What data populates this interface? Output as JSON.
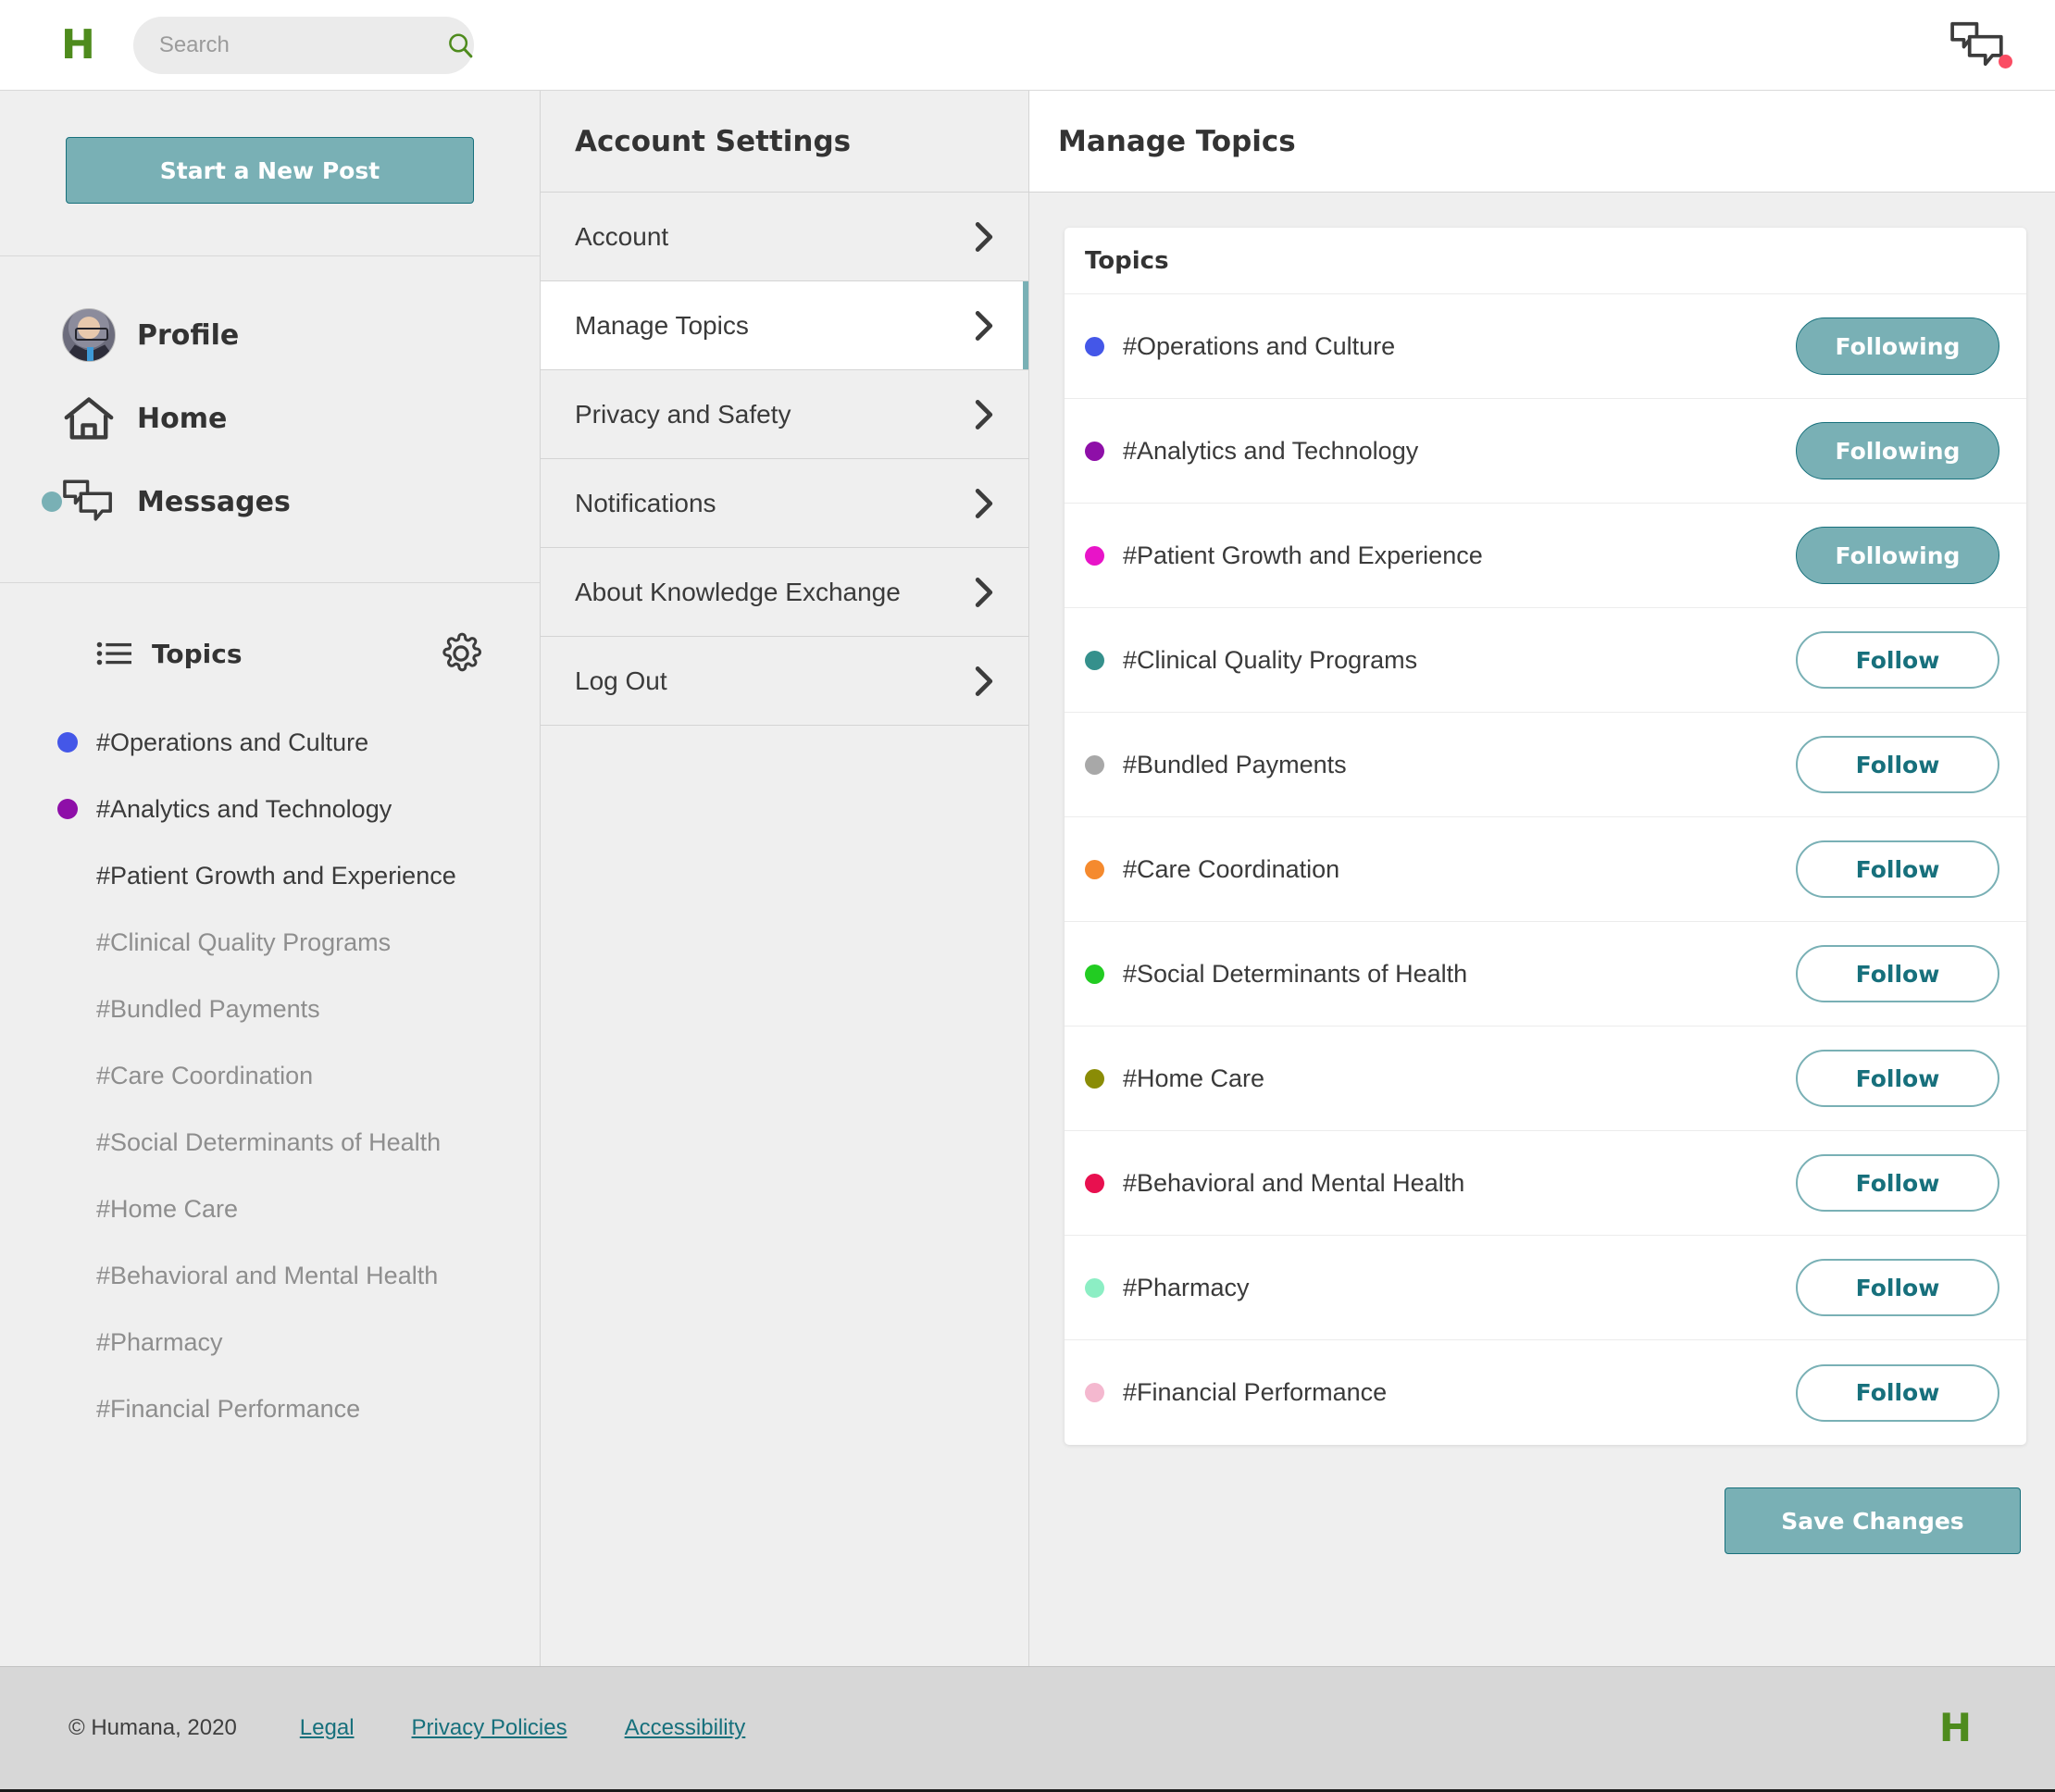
{
  "topbar": {
    "logo_text": "H",
    "search": {
      "placeholder": "Search",
      "value": ""
    }
  },
  "sidebar": {
    "new_post_label": "Start a New Post",
    "nav": [
      {
        "label": "Profile",
        "icon": "avatar",
        "indicator": false
      },
      {
        "label": "Home",
        "icon": "home-icon",
        "indicator": false
      },
      {
        "label": "Messages",
        "icon": "messages-icon",
        "indicator": true
      }
    ],
    "topics_header": "Topics",
    "topics": [
      {
        "label": "#Operations and Culture",
        "color": "#4457e8",
        "state": "active"
      },
      {
        "label": "#Analytics and Technology",
        "color": "#8e0fa8",
        "state": "active"
      },
      {
        "label": "#Patient Growth and Experience",
        "color": "",
        "state": "active"
      },
      {
        "label": "#Clinical Quality Programs",
        "color": "",
        "state": "muted"
      },
      {
        "label": "#Bundled Payments",
        "color": "",
        "state": "muted"
      },
      {
        "label": "#Care Coordination",
        "color": "",
        "state": "muted"
      },
      {
        "label": "#Social Determinants of Health",
        "color": "",
        "state": "muted"
      },
      {
        "label": "#Home Care",
        "color": "",
        "state": "muted"
      },
      {
        "label": "#Behavioral and Mental Health",
        "color": "",
        "state": "muted"
      },
      {
        "label": "#Pharmacy",
        "color": "",
        "state": "muted"
      },
      {
        "label": "#Financial Performance",
        "color": "",
        "state": "muted"
      }
    ]
  },
  "settings": {
    "title": "Account Settings",
    "items": [
      {
        "label": "Account",
        "selected": false
      },
      {
        "label": "Manage Topics",
        "selected": true
      },
      {
        "label": "Privacy and Safety",
        "selected": false
      },
      {
        "label": "Notifications",
        "selected": false
      },
      {
        "label": "About Knowledge Exchange",
        "selected": false
      },
      {
        "label": "Log Out",
        "selected": false
      }
    ]
  },
  "main": {
    "title": "Manage Topics",
    "card_header": "Topics",
    "save_label": "Save Changes",
    "follow_label": "Follow",
    "following_label": "Following",
    "rows": [
      {
        "label": "#Operations and Culture",
        "color": "#4457e8",
        "following": true
      },
      {
        "label": "#Analytics and Technology",
        "color": "#8e0fa8",
        "following": true
      },
      {
        "label": "#Patient Growth and Experience",
        "color": "#e814c8",
        "following": true
      },
      {
        "label": "#Clinical Quality Programs",
        "color": "#35908c",
        "following": false
      },
      {
        "label": "#Bundled Payments",
        "color": "#a8a8a8",
        "following": false
      },
      {
        "label": "#Care Coordination",
        "color": "#f58a2e",
        "following": false
      },
      {
        "label": "#Social Determinants of Health",
        "color": "#22cc22",
        "following": false
      },
      {
        "label": "#Home Care",
        "color": "#8a8c06",
        "following": false
      },
      {
        "label": "#Behavioral and Mental Health",
        "color": "#e8104f",
        "following": false
      },
      {
        "label": "#Pharmacy",
        "color": "#8ceec4",
        "following": false
      },
      {
        "label": "#Financial Performance",
        "color": "#f4b8cf",
        "following": false
      }
    ]
  },
  "footer": {
    "copyright": "© Humana, 2020",
    "links": [
      "Legal",
      "Privacy Policies",
      "Accessibility"
    ],
    "logo_text": "H"
  },
  "theme": {
    "brand_green": "#4e8b1d",
    "teal": "#79b0b5",
    "teal_dark": "#17707c",
    "notification_red": "#fa4d63"
  }
}
